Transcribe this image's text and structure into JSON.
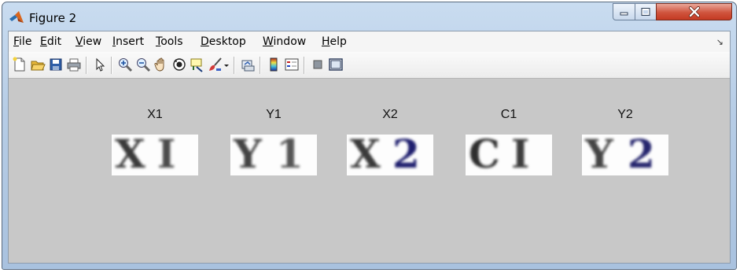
{
  "window": {
    "title": "Figure 2",
    "controls": {
      "minimize": "minimize",
      "maximize": "maximize",
      "close": "close"
    }
  },
  "menubar": {
    "items": [
      {
        "mnemonic": "F",
        "rest": "ile"
      },
      {
        "mnemonic": "E",
        "rest": "dit"
      },
      {
        "mnemonic": "V",
        "rest": "iew"
      },
      {
        "mnemonic": "I",
        "rest": "nsert"
      },
      {
        "mnemonic": "T",
        "rest": "ools"
      },
      {
        "mnemonic": "D",
        "rest": "esktop"
      },
      {
        "mnemonic": "W",
        "rest": "indow"
      },
      {
        "mnemonic": "H",
        "rest": "elp"
      }
    ],
    "overflow_icon": "dock-arrow-icon"
  },
  "toolbar": {
    "buttons": [
      "new-figure-icon",
      "open-file-icon",
      "save-icon",
      "print-icon",
      "edit-plot-arrow-icon",
      "zoom-in-icon",
      "zoom-out-icon",
      "pan-hand-icon",
      "rotate-3d-icon",
      "data-cursor-icon",
      "brush-icon",
      "brush-dropdown-icon",
      "link-plot-icon",
      "insert-colorbar-icon",
      "insert-legend-icon",
      "hide-plot-tools-icon",
      "show-plot-tools-icon"
    ]
  },
  "figure": {
    "panels": [
      {
        "label": "X1",
        "glyphs": [
          "X",
          "I"
        ],
        "tint": "#3a3a3a",
        "accent": "#4c4c4c"
      },
      {
        "label": "Y1",
        "glyphs": [
          "Y",
          "1"
        ],
        "tint": "#444444",
        "accent": "#555555"
      },
      {
        "label": "X2",
        "glyphs": [
          "X",
          "2"
        ],
        "tint": "#3a3a3a",
        "accent": "#1f1f6e"
      },
      {
        "label": "C1",
        "glyphs": [
          "C",
          "I"
        ],
        "tint": "#2e2e2e",
        "accent": "#3d3d3d"
      },
      {
        "label": "Y2",
        "glyphs": [
          "Y",
          "2"
        ],
        "tint": "#444444",
        "accent": "#26266e"
      }
    ]
  }
}
